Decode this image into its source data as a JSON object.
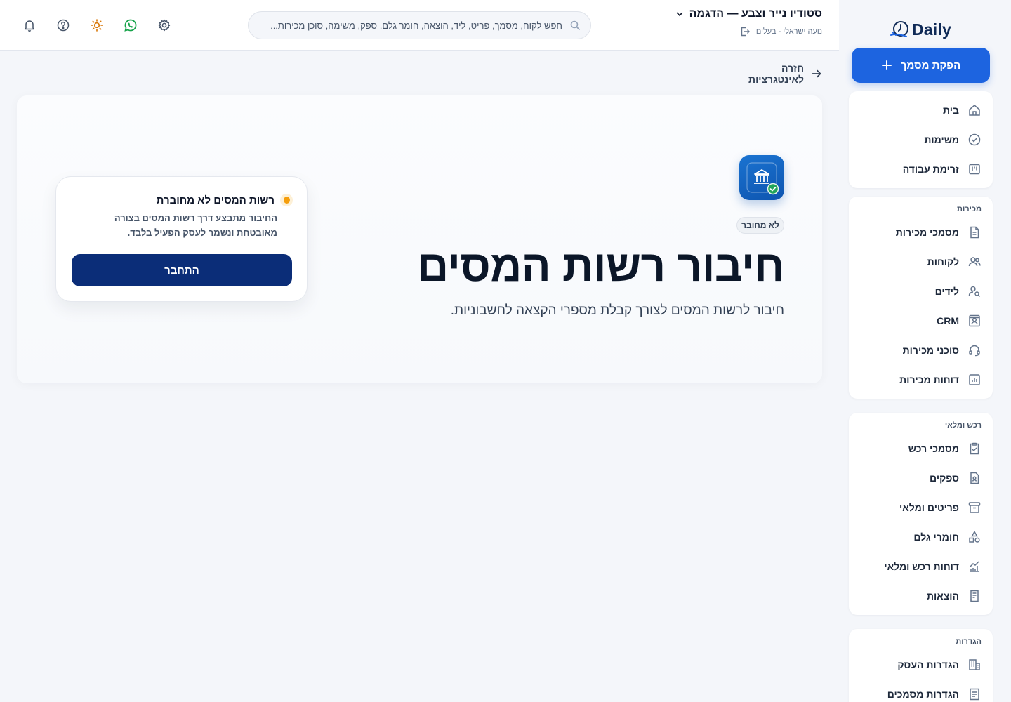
{
  "sidebar": {
    "logo_text": "Daily",
    "new_document_label": "הפקת מסמך",
    "main_items": [
      {
        "label": "בית",
        "icon": "home-icon"
      },
      {
        "label": "משימות",
        "icon": "check-circle-icon"
      },
      {
        "label": "זרימת עבודה",
        "icon": "kanban-icon"
      }
    ],
    "sales": {
      "title": "מכירות",
      "items": [
        {
          "label": "מסמכי מכירות",
          "icon": "document-icon"
        },
        {
          "label": "לקוחות",
          "icon": "users-icon"
        },
        {
          "label": "לידים",
          "icon": "user-search-icon"
        },
        {
          "label": "CRM",
          "icon": "contact-card-icon"
        },
        {
          "label": "סוכני מכירות",
          "icon": "headset-icon"
        },
        {
          "label": "דוחות מכירות",
          "icon": "bar-chart-icon"
        }
      ]
    },
    "procurement": {
      "title": "רכש ומלאי",
      "items": [
        {
          "label": "מסמכי רכש",
          "icon": "clipboard-check-icon"
        },
        {
          "label": "ספקים",
          "icon": "supplier-file-icon"
        },
        {
          "label": "פריטים ומלאי",
          "icon": "archive-box-icon"
        },
        {
          "label": "חומרי גלם",
          "icon": "shapes-icon"
        },
        {
          "label": "דוחות רכש ומלאי",
          "icon": "line-chart-icon"
        },
        {
          "label": "הוצאות",
          "icon": "receipt-icon"
        }
      ]
    },
    "settings": {
      "title": "הגדרות",
      "items": [
        {
          "label": "הגדרות העסק",
          "icon": "building-icon"
        },
        {
          "label": "הגדרות מסמכים",
          "icon": "document-settings-icon"
        }
      ]
    }
  },
  "header": {
    "business_name": "סטודיו נייר וצבע — הדגמה",
    "user_role": "נועה ישראלי - בעלים",
    "search_placeholder": "חפש לקוח, מסמך, פריט, ליד, הוצאה, חומר גלם, ספק, משימה, סוכן מכירות..."
  },
  "main": {
    "back_label": "חזרה לאינטגרציות",
    "status_badge": "לא מחובר",
    "title": "חיבור רשות המסים",
    "subtitle": "חיבור לרשות המסים לצורך קבלת מספרי הקצאה לחשבוניות.",
    "connect_card": {
      "title": "רשות המסים לא מחוברת",
      "description": "החיבור מתבצע דרך רשות המסים בצורה מאובטחת ונשמר לעסק הפעיל בלבד.",
      "button_label": "התחבר"
    }
  },
  "colors": {
    "primary_button": "#1d64e0",
    "connect_button": "#0b2d78",
    "warning_dot": "#f59e0b",
    "whatsapp": "#16a34a",
    "theme_sun": "#d97706"
  }
}
